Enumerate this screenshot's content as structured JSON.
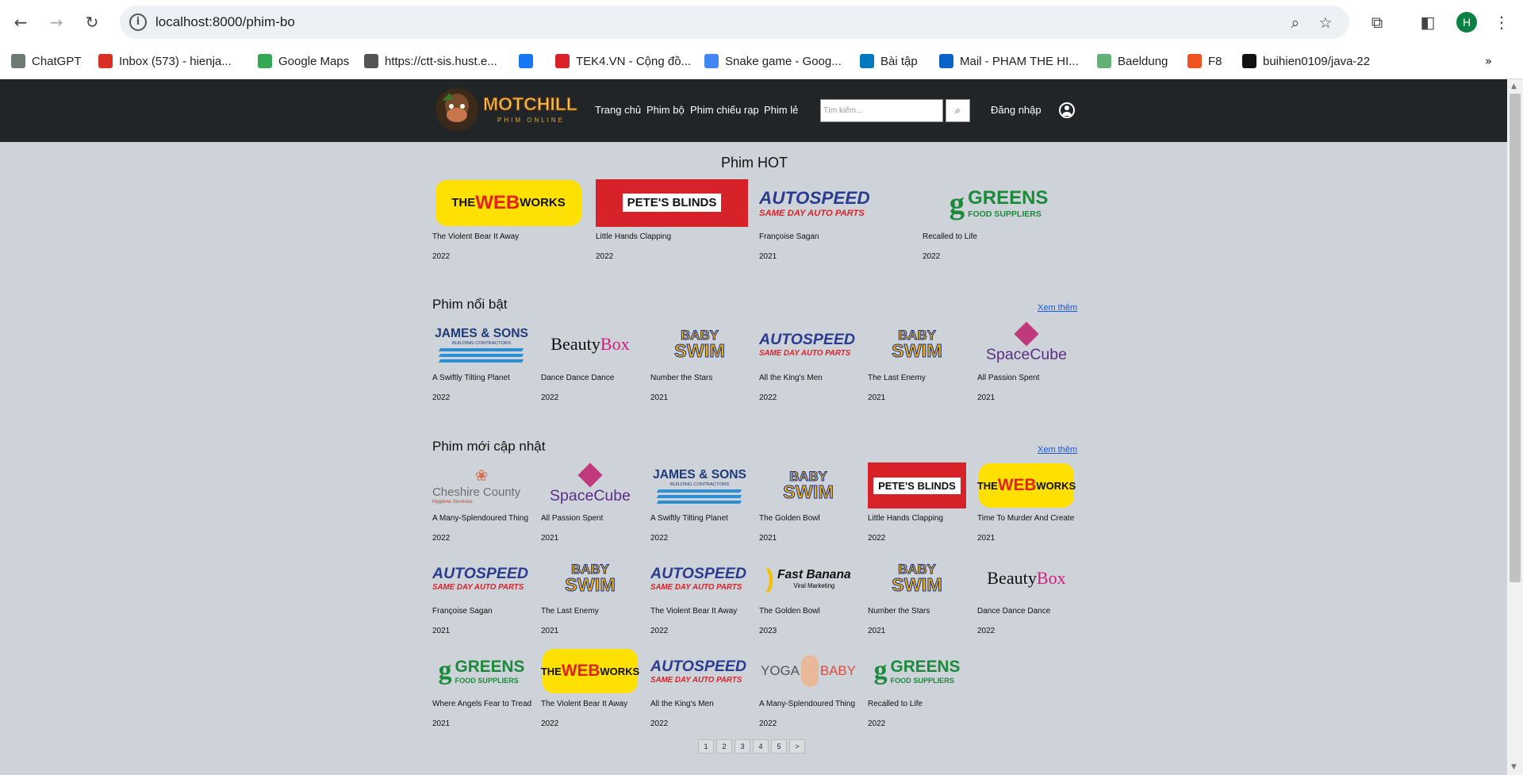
{
  "browser": {
    "url": "localhost:8000/phim-bo",
    "avatar_letter": "H",
    "bookmarks": [
      {
        "label": "ChatGPT",
        "icon": "chatgpt-icon",
        "color": "#6b7b74"
      },
      {
        "label": "Inbox (573) - hienja...",
        "icon": "gmail-icon",
        "color": "#d93025"
      },
      {
        "label": "Google Maps",
        "icon": "maps-icon",
        "color": "#34a853"
      },
      {
        "label": "https://ctt-sis.hust.e...",
        "icon": "globe-icon",
        "color": "#555555"
      },
      {
        "label": "",
        "icon": "facebook-icon",
        "color": "#1877f2"
      },
      {
        "label": "TEK4.VN - Cộng đồ...",
        "icon": "tek4-icon",
        "color": "#d8222a"
      },
      {
        "label": "Snake game - Goog...",
        "icon": "docs-icon",
        "color": "#4285f4"
      },
      {
        "label": "Bài tập",
        "icon": "trello-icon",
        "color": "#0079bf"
      },
      {
        "label": "Mail - PHAM THE HI...",
        "icon": "outlook-icon",
        "color": "#0a64c8"
      },
      {
        "label": "Baeldung",
        "icon": "baeldung-icon",
        "color": "#63b175"
      },
      {
        "label": "F8",
        "icon": "f8-icon",
        "color": "#f05123"
      },
      {
        "label": "buihien0109/java-22",
        "icon": "github-icon",
        "color": "#111111"
      }
    ]
  },
  "site": {
    "logo_text": "MOTCHILL",
    "logo_sub": "PHIM ONLINE",
    "nav": [
      "Trang chủ",
      "Phim bộ",
      "Phim chiếu rạp",
      "Phim lẻ"
    ],
    "search_placeholder": "Tìm kiếm...",
    "login": "Đăng nhập"
  },
  "sections": {
    "hot": {
      "title": "Phim HOT",
      "items": [
        {
          "logo": "webworks",
          "title": "The Violent Bear It Away",
          "year": "2022"
        },
        {
          "logo": "petes",
          "title": "Little Hands Clapping",
          "year": "2022"
        },
        {
          "logo": "autospeed",
          "title": "Françoise Sagan",
          "year": "2021"
        },
        {
          "logo": "greens",
          "title": "Recalled to Life",
          "year": "2022"
        }
      ]
    },
    "featured": {
      "title": "Phim nổi bật",
      "more": "Xem thêm",
      "items": [
        {
          "logo": "james",
          "title": "A Swiftly Tilting Planet",
          "year": "2022"
        },
        {
          "logo": "beauty",
          "title": "Dance Dance Dance",
          "year": "2022"
        },
        {
          "logo": "baby",
          "title": "Number the Stars",
          "year": "2021"
        },
        {
          "logo": "autospeed",
          "title": "All the King's Men",
          "year": "2022"
        },
        {
          "logo": "baby",
          "title": "The Last Enemy",
          "year": "2021"
        },
        {
          "logo": "space",
          "title": "All Passion Spent",
          "year": "2021"
        }
      ]
    },
    "latest": {
      "title": "Phim mới cập nhật",
      "more": "Xem thêm",
      "items": [
        {
          "logo": "cheshire",
          "title": "A Many-Splendoured Thing",
          "year": "2022"
        },
        {
          "logo": "space",
          "title": "All Passion Spent",
          "year": "2021"
        },
        {
          "logo": "james",
          "title": "A Swiftly Tilting Planet",
          "year": "2022"
        },
        {
          "logo": "baby",
          "title": "The Golden Bowl",
          "year": "2021"
        },
        {
          "logo": "petes",
          "title": "Little Hands Clapping",
          "year": "2022"
        },
        {
          "logo": "webworks",
          "title": "Time To Murder And Create",
          "year": "2021"
        },
        {
          "logo": "autospeed",
          "title": "Françoise Sagan",
          "year": "2021"
        },
        {
          "logo": "baby",
          "title": "The Last Enemy",
          "year": "2021"
        },
        {
          "logo": "autospeed",
          "title": "The Violent Bear It Away",
          "year": "2022"
        },
        {
          "logo": "banana",
          "title": "The Golden Bowl",
          "year": "2023"
        },
        {
          "logo": "baby",
          "title": "Number the Stars",
          "year": "2021"
        },
        {
          "logo": "beauty",
          "title": "Dance Dance Dance",
          "year": "2022"
        },
        {
          "logo": "greens",
          "title": "Where Angels Fear to Tread",
          "year": "2021"
        },
        {
          "logo": "webworks",
          "title": "The Violent Bear It Away",
          "year": "2022"
        },
        {
          "logo": "autospeed",
          "title": "All the King's Men",
          "year": "2022"
        },
        {
          "logo": "yoga",
          "title": "A Many-Splendoured Thing",
          "year": "2022"
        },
        {
          "logo": "greens",
          "title": "Recalled to Life",
          "year": "2022"
        }
      ]
    }
  },
  "logos": {
    "webworks": {
      "a": "THE",
      "b": "WEB",
      "c": "WORKS"
    },
    "petes": {
      "a": "PETE'S BLINDS"
    },
    "autospeed": {
      "a": "AUTOSPEED",
      "b": "SAME DAY AUTO PARTS"
    },
    "greens": {
      "a": "g",
      "b": "GREENS",
      "c": "FOOD SUPPLIERS"
    },
    "james": {
      "a": "JAMES & SONS",
      "b": "BUILDING CONTRACTORS"
    },
    "beauty": {
      "a": "Beauty",
      "b": "Box"
    },
    "baby": {
      "a": "BABY",
      "b": "SWIM"
    },
    "space": {
      "a": "SpaceCube"
    },
    "cheshire": {
      "a": "Cheshire County",
      "b": "Hygiene Services"
    },
    "banana": {
      "a": "Fast Banana",
      "b": "Viral Marketing"
    },
    "yoga": {
      "a": "YOGA",
      "b": "BABY"
    }
  },
  "pagination": [
    "1",
    "2",
    "3",
    "4",
    "5",
    ">"
  ]
}
